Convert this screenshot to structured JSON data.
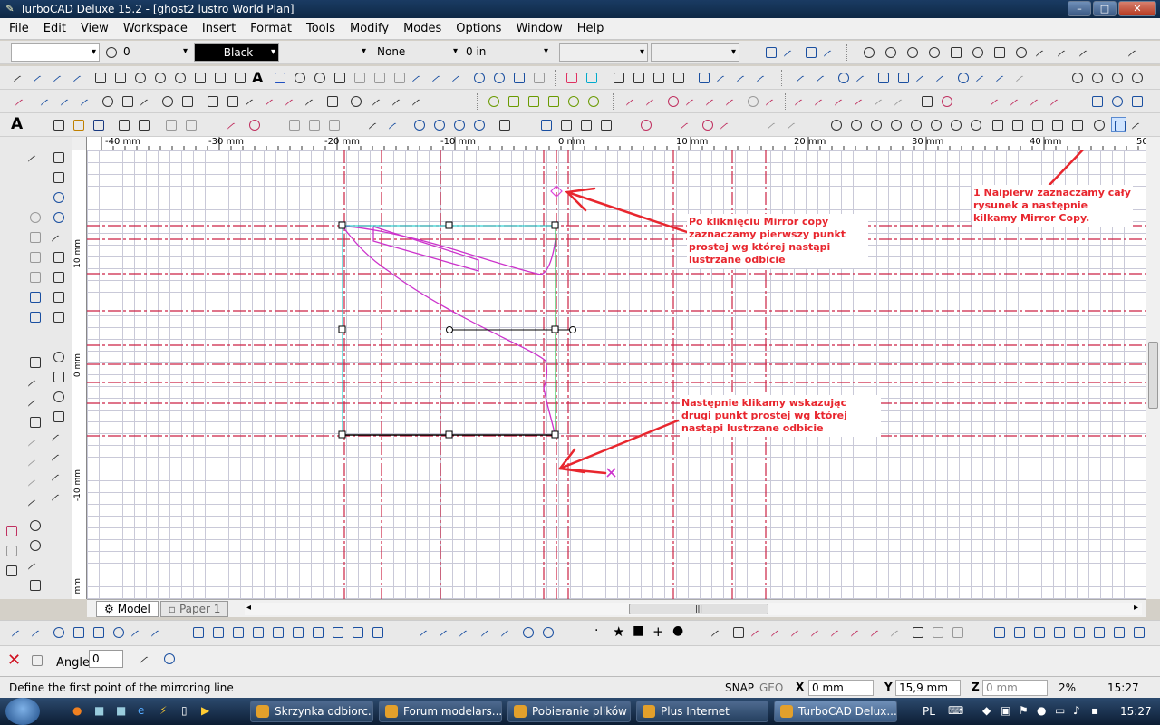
{
  "window": {
    "title": "TurboCAD Deluxe 15.2 - [ghost2 lustro World Plan]"
  },
  "menu": [
    "File",
    "Edit",
    "View",
    "Workspace",
    "Insert",
    "Format",
    "Tools",
    "Modify",
    "Modes",
    "Options",
    "Window",
    "Help"
  ],
  "property_bar": {
    "layer_value": "0",
    "color_value": "Black",
    "fill_value": "None",
    "width_value": "0 in"
  },
  "ruler": {
    "unit": "mm",
    "h_labels": [
      "-40 mm",
      "-30 mm",
      "-20 mm",
      "-10 mm",
      "0 mm",
      "10 mm",
      "20 mm",
      "30 mm",
      "40 mm",
      "50"
    ],
    "v_labels": [
      "10 mm",
      "0 mm",
      "-10 mm",
      "mm"
    ]
  },
  "annotations": {
    "note1": "1 Naipierw zaznaczamy cały rysunek a następnie kilkamy Mirror Copy.",
    "note2": "Po kliknięciu Mirror copy zaznaczamy pierwszy punkt prostej wg której nastąpi lustrzane odbicie",
    "note3": "Następnie klikamy wskazując drugi punkt prostej wg której nastąpi lustrzane odbicie"
  },
  "tabs": {
    "model": "Model",
    "paper": "Paper 1"
  },
  "inspector": {
    "angle_label": "Angle",
    "angle_value": "0"
  },
  "status": {
    "message": "Define the first point of the mirroring line",
    "snap": "SNAP",
    "geo": "GEO",
    "x_value": "0 mm",
    "y_value": "15,9 mm",
    "z_value": "0 mm",
    "zoom": "2%",
    "time": "15:27"
  },
  "taskbar": {
    "items": [
      "Skrzynka odbiorc...",
      "Forum modelars...",
      "Pobieranie plików",
      "Plus Internet",
      "TurboCAD Delux..."
    ],
    "lang": "PL",
    "clock": "15:27"
  },
  "colors": {
    "accent_red": "#e8262e",
    "magenta": "#cc33cc",
    "guide_red": "#cc2244"
  }
}
